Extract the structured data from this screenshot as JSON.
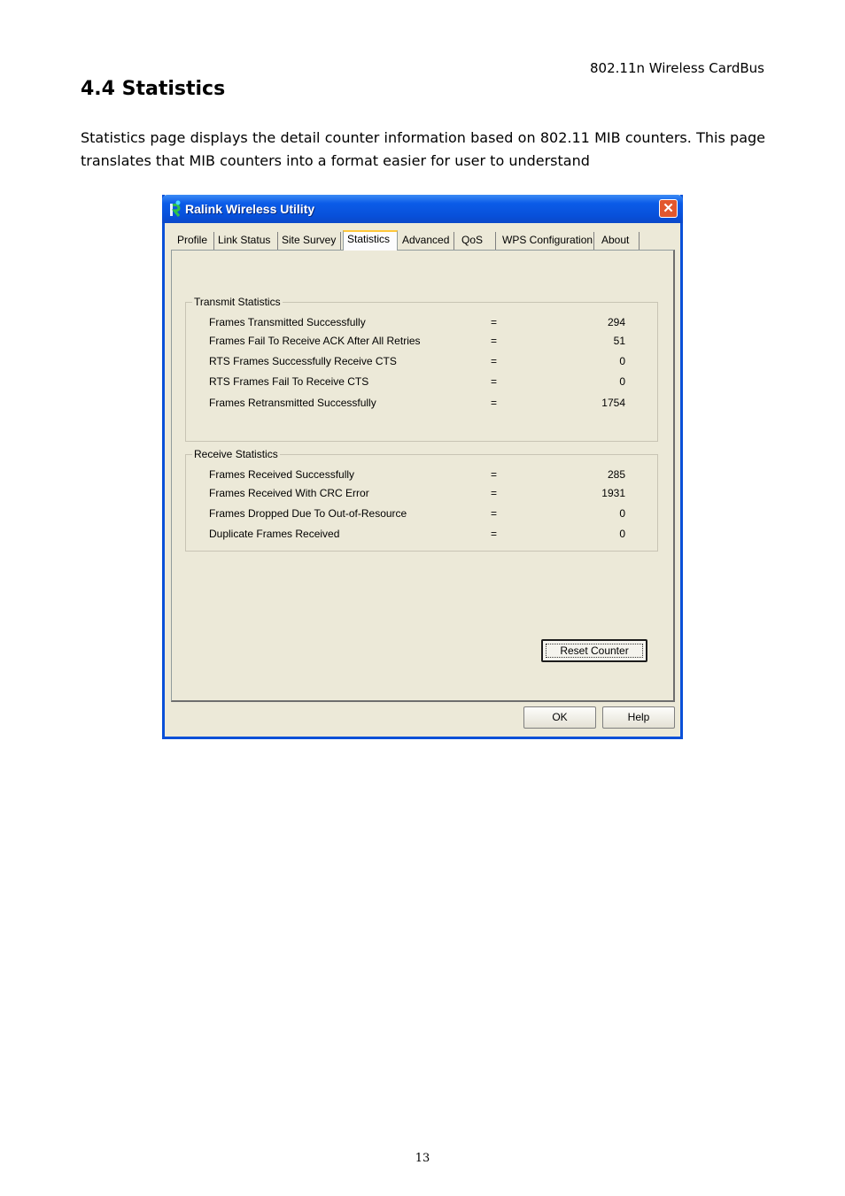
{
  "page": {
    "header": "802.11n Wireless CardBus",
    "section_title": "4.4 Statistics",
    "intro": "Statistics page displays the detail counter information based on 802.11 MIB counters. This page translates that MIB counters into a format easier for user to understand",
    "page_number": "13"
  },
  "window": {
    "title": "Ralink Wireless Utility",
    "close_icon": "close-icon",
    "tabs": [
      {
        "label": "Profile"
      },
      {
        "label": "Link Status"
      },
      {
        "label": "Site Survey"
      },
      {
        "label": "Statistics",
        "active": true
      },
      {
        "label": "Advanced"
      },
      {
        "label": "QoS"
      },
      {
        "label": "WPS Configuration"
      },
      {
        "label": "About"
      }
    ],
    "transmit": {
      "title": "Transmit Statistics",
      "rows": [
        {
          "label": "Frames Transmitted Successfully",
          "eq": "=",
          "value": "294"
        },
        {
          "label": "Frames Fail To Receive ACK After All Retries",
          "eq": "=",
          "value": "51"
        },
        {
          "label": "RTS Frames Successfully Receive CTS",
          "eq": "=",
          "value": "0"
        },
        {
          "label": "RTS Frames Fail To Receive CTS",
          "eq": "=",
          "value": "0"
        },
        {
          "label": "Frames Retransmitted Successfully",
          "eq": "=",
          "value": "1754"
        }
      ]
    },
    "receive": {
      "title": "Receive Statistics",
      "rows": [
        {
          "label": "Frames Received Successfully",
          "eq": "=",
          "value": "285"
        },
        {
          "label": "Frames Received With CRC Error",
          "eq": "=",
          "value": "1931"
        },
        {
          "label": "Frames Dropped Due To Out-of-Resource",
          "eq": "=",
          "value": "0"
        },
        {
          "label": "Duplicate Frames Received",
          "eq": "=",
          "value": "0"
        }
      ]
    },
    "reset_label": "Reset Counter",
    "ok_label": "OK",
    "help_label": "Help"
  }
}
